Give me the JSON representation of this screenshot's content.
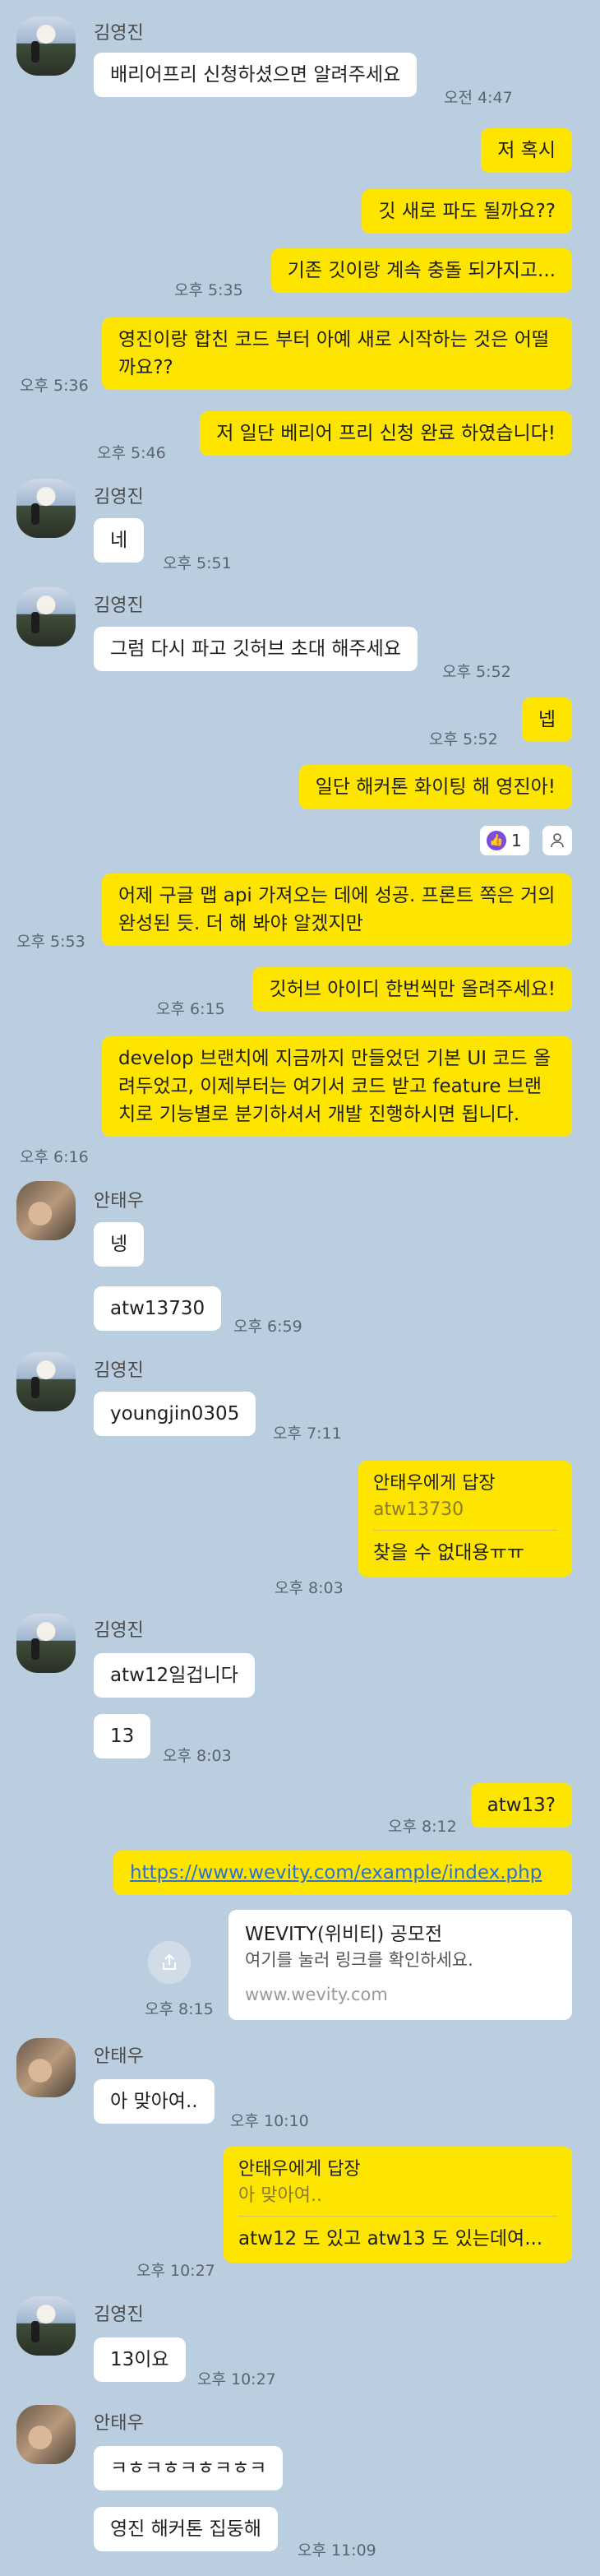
{
  "messages": {
    "m1": {
      "sender": "김영진",
      "text": "배리어프리 신청하셨으면 알려주세요",
      "time": "오전 4:47"
    },
    "m2": {
      "text": "저 혹시"
    },
    "m3": {
      "text": "깃 새로 파도 될까요??"
    },
    "m4": {
      "text": "기존 깃이랑 계속 충돌 되가지고...",
      "time": "오후 5:35"
    },
    "m5": {
      "text": "영진이랑 합친 코드 부터 아예 새로 시작하는 것은 어떨까요??",
      "time": "오후 5:36"
    },
    "m6": {
      "text": "저 일단 베리어 프리 신청 완료 하였습니다!",
      "time": "오후 5:46"
    },
    "m7": {
      "sender": "김영진",
      "text": "네",
      "time": "오후 5:51"
    },
    "m8": {
      "sender": "김영진",
      "text": "그럼 다시 파고 깃허브 초대 해주세요",
      "time": "오후 5:52"
    },
    "m9": {
      "text": "넵",
      "time": "오후 5:52"
    },
    "m10": {
      "text": "일단 해커톤 화이팅 해 영진아!",
      "reaction_count": "1"
    },
    "m11": {
      "text": "어제 구글 맵 api 가져오는 데에 성공. 프론트 쪽은 거의 완성된 듯. 더 해 봐야 알겠지만",
      "time": "오후 5:53"
    },
    "m12": {
      "text": "깃허브 아이디 한번씩만 올려주세요!",
      "time": "오후 6:15"
    },
    "m13": {
      "text": "develop 브랜치에 지금까지 만들었던 기본 UI 코드 올려두었고, 이제부터는 여기서 코드 받고 feature 브랜치로 기능별로 분기하셔서 개발 진행하시면 됩니다.",
      "time": "오후 6:16"
    },
    "m14": {
      "sender": "안태우",
      "text": "넹"
    },
    "m15": {
      "text": "atw13730",
      "time": "오후 6:59"
    },
    "m16": {
      "sender": "김영진",
      "text": "youngjin0305",
      "time": "오후 7:11"
    },
    "m17": {
      "reply_to": "안태우에게 답장",
      "quote": "atw13730",
      "text": "찾을 수 없대용ㅠㅠ",
      "time": "오후 8:03"
    },
    "m18": {
      "sender": "김영진",
      "text": "atw12일겁니다"
    },
    "m19": {
      "text": "13",
      "time": "오후 8:03"
    },
    "m20": {
      "text": "atw13?",
      "time": "오후 8:12"
    },
    "m21": {
      "link": "https://www.wevity.com/example/index.php",
      "card_title": "WEVITY(위비티) 공모전",
      "card_desc": "여기를 눌러 링크를 확인하세요.",
      "card_domain": "www.wevity.com",
      "time": "오후 8:15"
    },
    "m22": {
      "sender": "안태우",
      "text": "아 맞아여..",
      "time": "오후 10:10"
    },
    "m23": {
      "reply_to": "안태우에게 답장",
      "quote": "아 맞아여..",
      "text": "atw12 도 있고 atw13 도 있는데여...",
      "time": "오후 10:27"
    },
    "m24": {
      "sender": "김영진",
      "text": "13이요",
      "time": "오후 10:27"
    },
    "m25": {
      "sender": "안태우",
      "text": "ㅋㅎㅋㅎㅋㅎㅋㅎㅋ"
    },
    "m26": {
      "text": "영진 해커톤 집둥해",
      "time": "오후 11:09"
    }
  },
  "colors": {
    "background": "#bacee0",
    "outgoing": "#fee500",
    "incoming": "#ffffff"
  },
  "icons": {
    "share": "share-icon",
    "like": "thumbs-up-icon",
    "person": "person-icon"
  }
}
